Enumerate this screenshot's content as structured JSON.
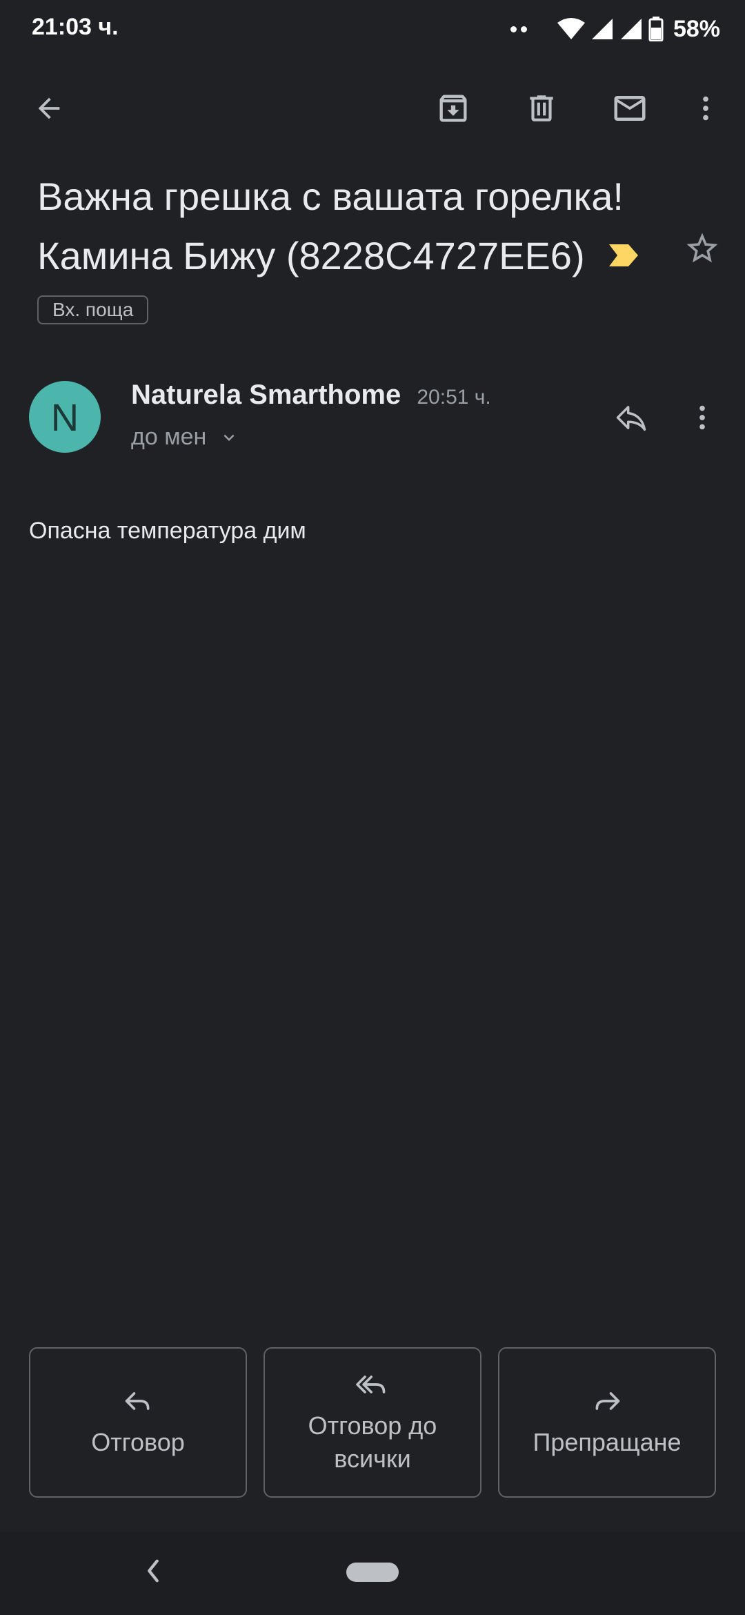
{
  "status_bar": {
    "time": "21:03 ч.",
    "battery": "58%"
  },
  "subject": {
    "line1": "Важна грешка с вашата горелка!",
    "line2": "Камина Бижу (8228C4727EE6)"
  },
  "label": "Вх. поща",
  "message": {
    "avatar_letter": "N",
    "sender": "Naturela Smarthome",
    "time": "20:51 ч.",
    "recipient": "до мен",
    "body": "Опасна температура дим"
  },
  "actions": {
    "reply": "Отговор",
    "reply_all": "Отговор до всички",
    "forward": "Препращане"
  },
  "colors": {
    "background": "#202124",
    "avatar": "#4db6ac",
    "importance": "#fdd663"
  },
  "icons": {
    "back": "arrow-left-icon",
    "archive": "archive-icon",
    "delete": "trash-icon",
    "mark_unread": "mail-icon",
    "more": "more-vert-icon",
    "star": "star-outline-icon",
    "importance": "importance-marker-icon",
    "reply": "reply-icon",
    "reply_all": "reply-all-icon",
    "forward": "forward-icon"
  }
}
